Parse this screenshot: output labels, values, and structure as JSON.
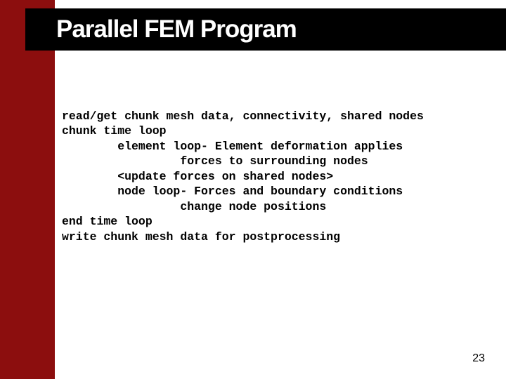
{
  "title": "Parallel FEM Program",
  "code_lines": [
    "read/get chunk mesh data, connectivity, shared nodes",
    "chunk time loop",
    "        element loop- Element deformation applies",
    "                 forces to surrounding nodes",
    "        <update forces on shared nodes>",
    "        node loop- Forces and boundary conditions",
    "                 change node positions",
    "end time loop",
    "write chunk mesh data for postprocessing"
  ],
  "page_number": "23"
}
